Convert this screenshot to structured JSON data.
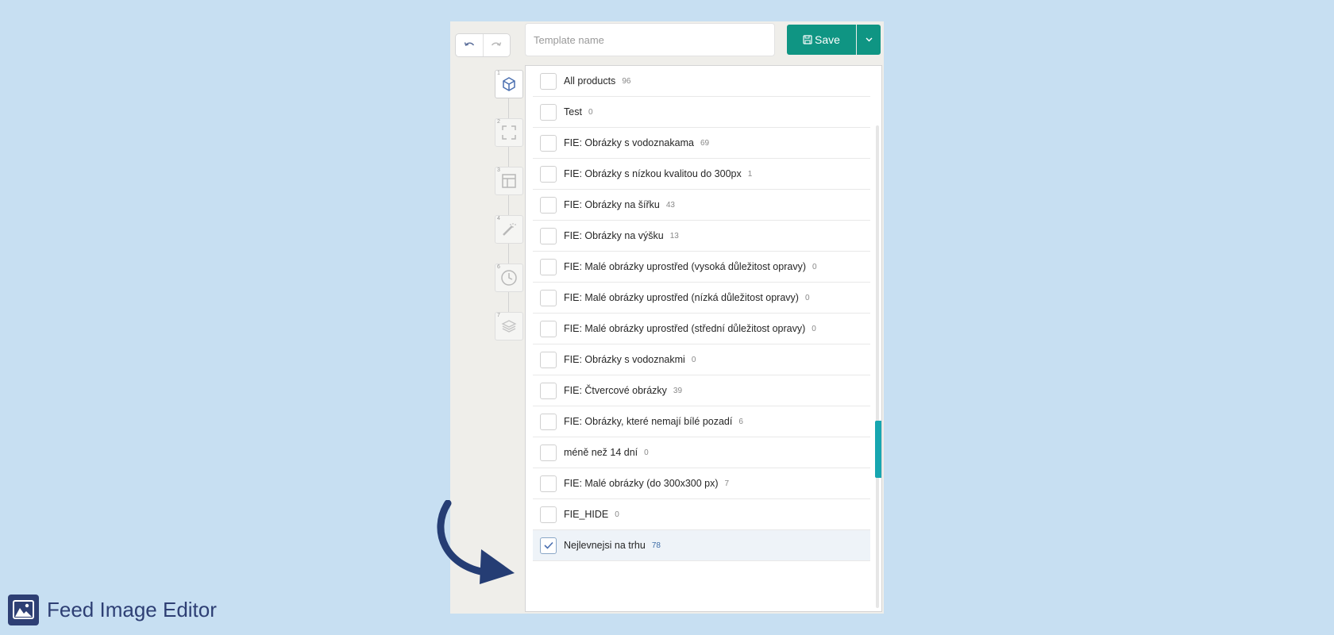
{
  "header": {
    "template_placeholder": "Template name",
    "save_label": "Save"
  },
  "steps": [
    {
      "num": "1",
      "icon": "cube-icon",
      "active": true
    },
    {
      "num": "2",
      "icon": "crop-frame-icon"
    },
    {
      "num": "3",
      "icon": "layout-icon"
    },
    {
      "num": "4",
      "icon": "magic-wand-icon"
    },
    {
      "num": "6",
      "icon": "clock-icon"
    },
    {
      "num": "7",
      "icon": "layers-icon"
    }
  ],
  "product_groups": [
    {
      "label": "All products",
      "count": "96",
      "checked": false
    },
    {
      "label": "Test",
      "count": "0",
      "checked": false
    },
    {
      "label": "FIE: Obrázky s vodoznakama",
      "count": "69",
      "checked": false
    },
    {
      "label": "FIE: Obrázky s nízkou kvalitou do 300px",
      "count": "1",
      "checked": false
    },
    {
      "label": "FIE: Obrázky na šířku",
      "count": "43",
      "checked": false
    },
    {
      "label": "FIE: Obrázky na výšku",
      "count": "13",
      "checked": false
    },
    {
      "label": "FIE: Malé obrázky uprostřed (vysoká důležitost opravy)",
      "count": "0",
      "checked": false
    },
    {
      "label": "FIE: Malé obrázky uprostřed (nízká důležitost opravy)",
      "count": "0",
      "checked": false
    },
    {
      "label": "FIE: Malé obrázky uprostřed (střední důležitost opravy)",
      "count": "0",
      "checked": false
    },
    {
      "label": "FIE: Obrázky s vodoznakmi",
      "count": "0",
      "checked": false
    },
    {
      "label": "FIE: Čtvercové obrázky",
      "count": "39",
      "checked": false
    },
    {
      "label": "FIE: Obrázky, které nemají bílé pozadí",
      "count": "6",
      "checked": false
    },
    {
      "label": "méně než 14 dní",
      "count": "0",
      "checked": false
    },
    {
      "label": "FIE: Malé obrázky (do 300x300 px)",
      "count": "7",
      "checked": false
    },
    {
      "label": "FIE_HIDE",
      "count": "0",
      "checked": false
    },
    {
      "label": "Nejlevnejsi na trhu",
      "count": "78",
      "checked": true
    }
  ],
  "brand": {
    "name": "Feed Image Editor",
    "color": "#2e3f74"
  },
  "colors": {
    "accent": "#0f9583",
    "scrollbar": "#17a6b0",
    "background": "#c7dff2"
  }
}
